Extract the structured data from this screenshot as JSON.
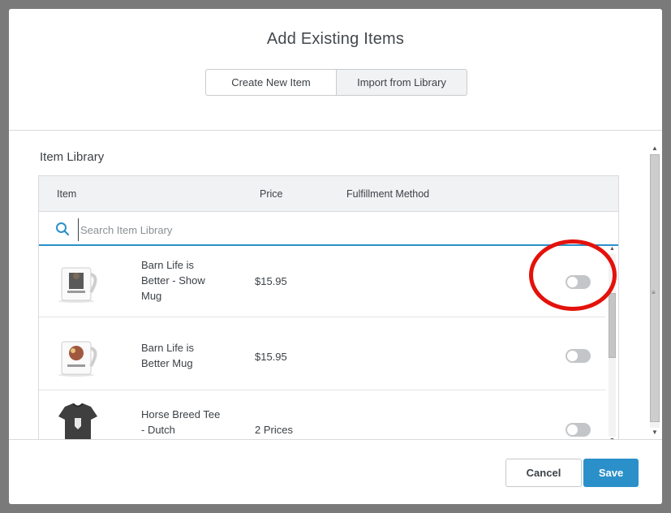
{
  "modal": {
    "title": "Add Existing Items",
    "tabs": [
      {
        "label": "Create New Item",
        "active": false
      },
      {
        "label": "Import from Library",
        "active": true
      }
    ]
  },
  "library": {
    "section_title": "Item Library",
    "columns": [
      "Item",
      "Price",
      "Fulfillment Method"
    ],
    "search": {
      "placeholder": "Search Item Library",
      "value": ""
    },
    "items": [
      {
        "name": "Barn Life is Better - Show Mug",
        "price": "$15.95",
        "enabled": false,
        "thumbnail": "mug-icon"
      },
      {
        "name": "Barn Life is Better Mug",
        "price": "$15.95",
        "enabled": false,
        "thumbnail": "mug-icon"
      },
      {
        "name": "Horse Breed Tee - Dutch",
        "price": "2 Prices",
        "enabled": false,
        "thumbnail": "tshirt-icon"
      }
    ]
  },
  "footer": {
    "cancel_label": "Cancel",
    "save_label": "Save"
  },
  "colors": {
    "accent": "#2b90c9",
    "annotation": "#e3120b",
    "toggle_off": "#c3c6c9"
  }
}
